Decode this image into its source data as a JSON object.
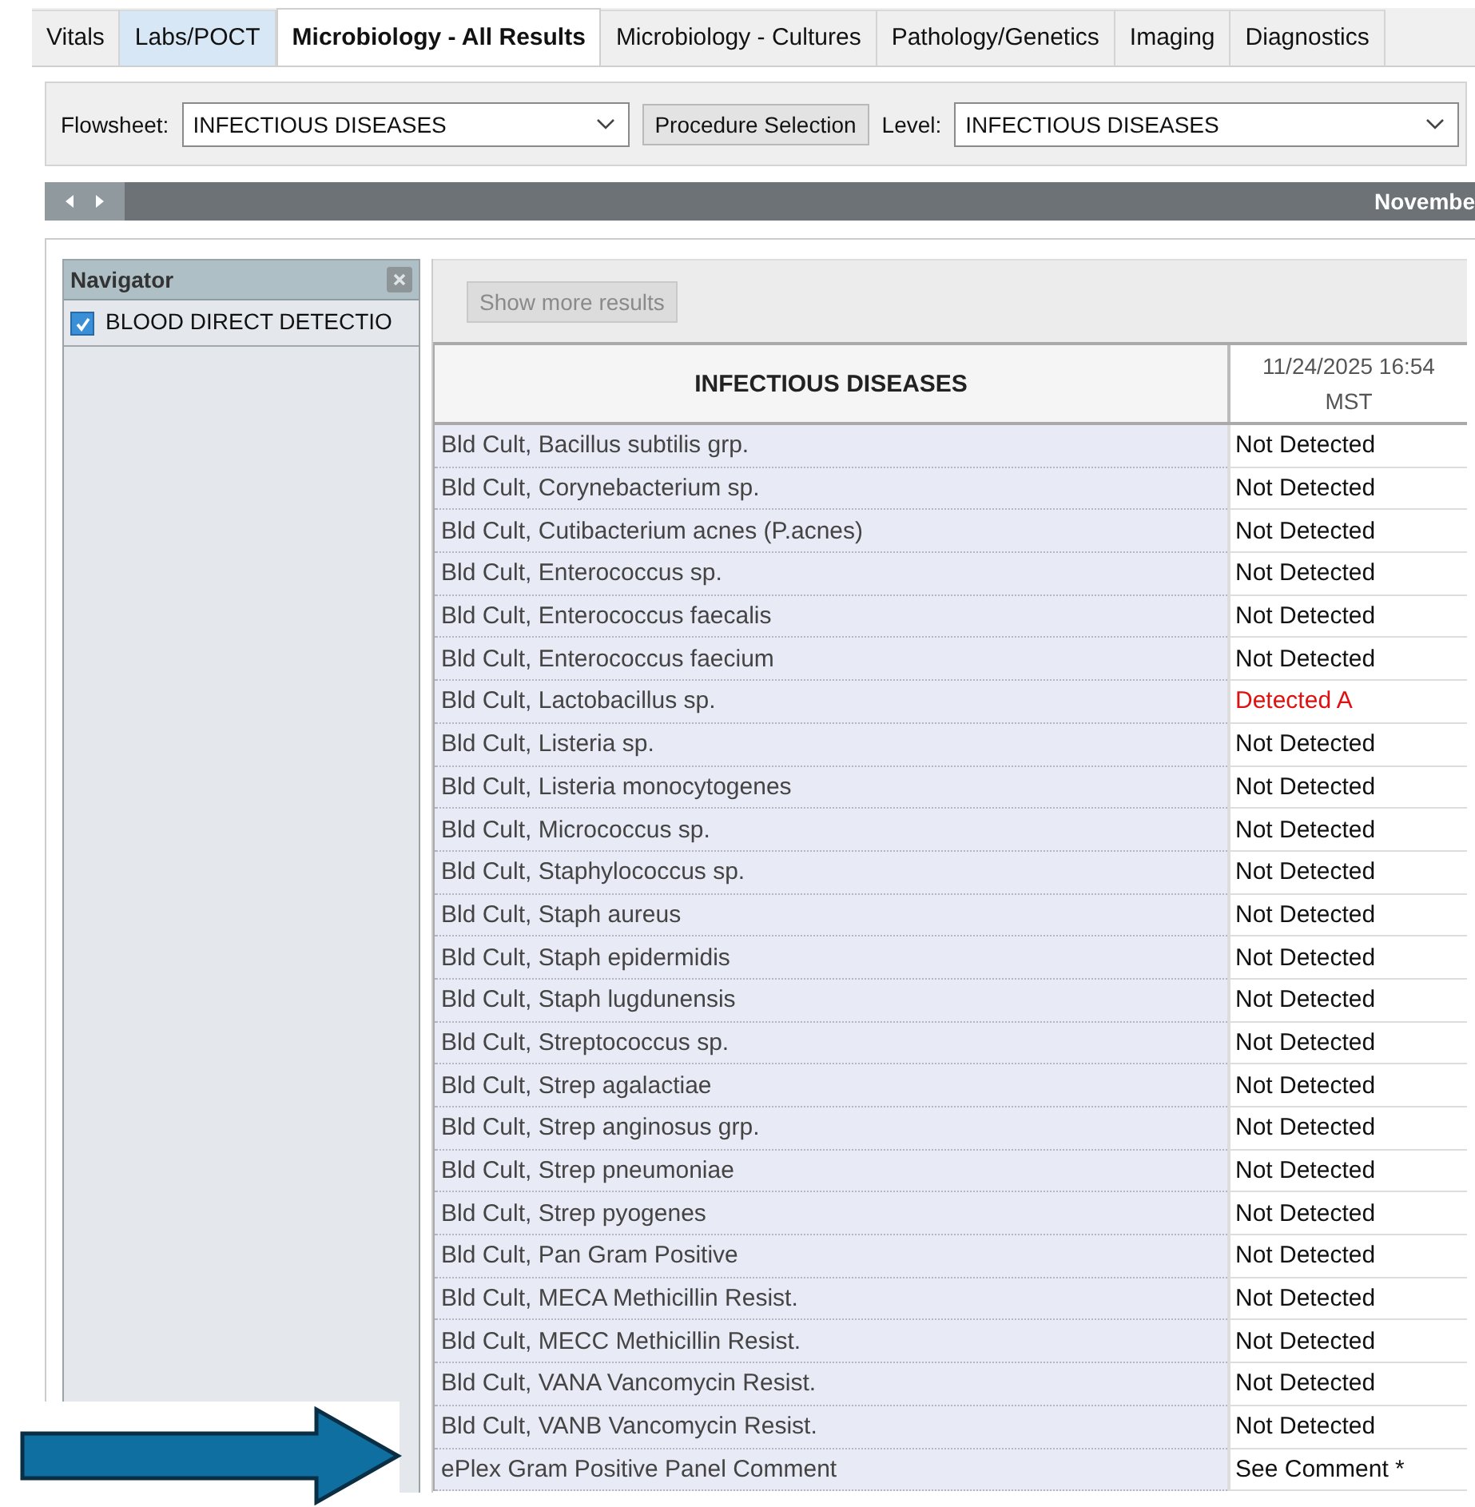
{
  "tabs": [
    {
      "label": "Vitals",
      "selected": false,
      "hovered": false
    },
    {
      "label": "Labs/POCT",
      "selected": false,
      "hovered": true
    },
    {
      "label": "Microbiology - All Results",
      "selected": true,
      "hovered": false
    },
    {
      "label": "Microbiology - Cultures",
      "selected": false,
      "hovered": false
    },
    {
      "label": "Pathology/Genetics",
      "selected": false,
      "hovered": false
    },
    {
      "label": "Imaging",
      "selected": false,
      "hovered": false
    },
    {
      "label": "Diagnostics",
      "selected": false,
      "hovered": false
    }
  ],
  "toolbar": {
    "flowsheet_label": "Flowsheet:",
    "flowsheet_value": "INFECTIOUS DISEASES",
    "procedure_button": "Procedure Selection",
    "level_label": "Level:",
    "level_value": "INFECTIOUS DISEASES"
  },
  "date_bar": {
    "label": "Novembe"
  },
  "navigator": {
    "title": "Navigator",
    "items": [
      {
        "label": "BLOOD DIRECT DETECTIO",
        "checked": true
      }
    ]
  },
  "results": {
    "show_more_button": {
      "label": "Show more results",
      "disabled": true
    },
    "columns": [
      "INFECTIOUS DISEASES",
      "11/24/2025 16:54 MST"
    ],
    "rows": [
      {
        "name": "Bld Cult, Bacillus subtilis grp.",
        "value": "Not Detected",
        "abnormal": false
      },
      {
        "name": "Bld Cult, Corynebacterium sp.",
        "value": "Not Detected",
        "abnormal": false
      },
      {
        "name": "Bld Cult, Cutibacterium acnes (P.acnes)",
        "value": "Not Detected",
        "abnormal": false
      },
      {
        "name": "Bld Cult, Enterococcus sp.",
        "value": "Not Detected",
        "abnormal": false
      },
      {
        "name": "Bld Cult, Enterococcus faecalis",
        "value": "Not Detected",
        "abnormal": false
      },
      {
        "name": "Bld Cult, Enterococcus faecium",
        "value": "Not Detected",
        "abnormal": false
      },
      {
        "name": "Bld Cult, Lactobacillus sp.",
        "value": "Detected A",
        "abnormal": true
      },
      {
        "name": "Bld Cult, Listeria sp.",
        "value": "Not Detected",
        "abnormal": false
      },
      {
        "name": "Bld Cult, Listeria monocytogenes",
        "value": "Not Detected",
        "abnormal": false
      },
      {
        "name": "Bld Cult, Micrococcus sp.",
        "value": "Not Detected",
        "abnormal": false
      },
      {
        "name": "Bld Cult, Staphylococcus sp.",
        "value": "Not Detected",
        "abnormal": false
      },
      {
        "name": "Bld Cult, Staph aureus",
        "value": "Not Detected",
        "abnormal": false
      },
      {
        "name": "Bld Cult, Staph epidermidis",
        "value": "Not Detected",
        "abnormal": false
      },
      {
        "name": "Bld Cult, Staph lugdunensis",
        "value": "Not Detected",
        "abnormal": false
      },
      {
        "name": "Bld Cult, Streptococcus sp.",
        "value": "Not Detected",
        "abnormal": false
      },
      {
        "name": "Bld Cult, Strep agalactiae",
        "value": "Not Detected",
        "abnormal": false
      },
      {
        "name": "Bld Cult, Strep anginosus grp.",
        "value": "Not Detected",
        "abnormal": false
      },
      {
        "name": "Bld Cult, Strep pneumoniae",
        "value": "Not Detected",
        "abnormal": false
      },
      {
        "name": "Bld Cult, Strep pyogenes",
        "value": "Not Detected",
        "abnormal": false
      },
      {
        "name": "Bld Cult, Pan Gram Positive",
        "value": "Not Detected",
        "abnormal": false
      },
      {
        "name": "Bld Cult, MECA Methicillin Resist.",
        "value": "Not Detected",
        "abnormal": false
      },
      {
        "name": "Bld Cult, MECC Methicillin Resist.",
        "value": "Not Detected",
        "abnormal": false
      },
      {
        "name": "Bld Cult, VANA Vancomycin Resist.",
        "value": "Not Detected",
        "abnormal": false
      },
      {
        "name": "Bld Cult, VANB Vancomycin Resist.",
        "value": "Not Detected",
        "abnormal": false
      },
      {
        "name": "ePlex Gram Positive Panel Comment",
        "value": "See Comment *",
        "abnormal": false
      }
    ]
  }
}
